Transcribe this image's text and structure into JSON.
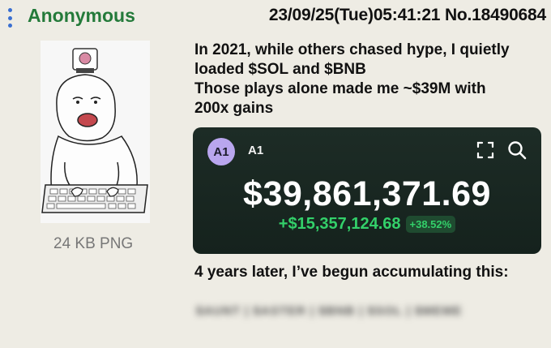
{
  "post": {
    "name": "Anonymous",
    "datetime": "23/09/25(Tue)05:41:21",
    "post_number": "No.18490684",
    "file_info": "24 KB PNG",
    "text_lines": [
      "In 2021, while others chased hype, I quietly",
      "loaded $SOL and $BNB",
      "Those plays alone made me ~$39M with",
      "200x gains"
    ],
    "footer_line": "4 years later, I’ve begun accumulating this:",
    "blurred_tokens": "$AUNT | $ASTER | $BNB | $SOL | $MEME"
  },
  "card": {
    "avatar_label": "A1",
    "account_name": "A1",
    "balance": "$39,861,371.69",
    "change_abs": "+$15,357,124.68",
    "change_pct": "+38.52%",
    "colors": {
      "positive": "#33d06a",
      "background": "#16251f",
      "avatar": "#b9a6ee"
    }
  },
  "icons": {
    "menu": "vertical-dots-icon",
    "expand": "expand-icon",
    "search": "search-icon",
    "thumbnail": "wojak-keyboard-image"
  },
  "colors": {
    "name": "#247a3a",
    "menu_dots": "#3a6fd1",
    "page_bg": "#eeece4"
  }
}
